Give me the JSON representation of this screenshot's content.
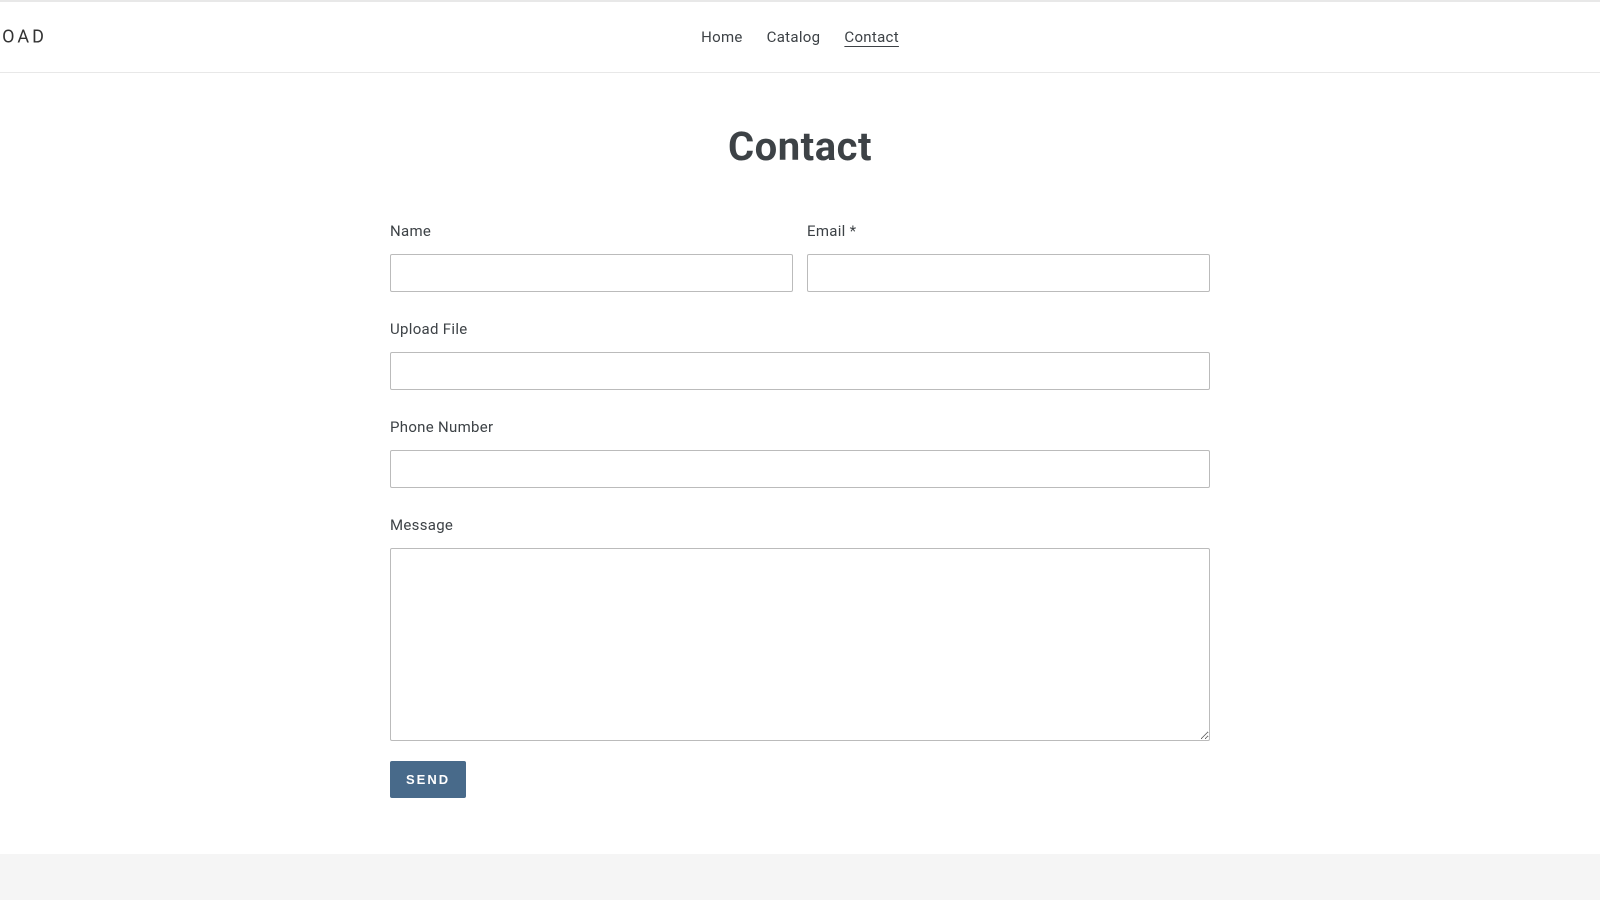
{
  "brand": "LOAD",
  "nav": {
    "home": "Home",
    "catalog": "Catalog",
    "contact": "Contact"
  },
  "page": {
    "title": "Contact"
  },
  "form": {
    "name_label": "Name",
    "email_label": "Email *",
    "upload_label": "Upload File",
    "phone_label": "Phone Number",
    "message_label": "Message",
    "send_label": "SEND",
    "name_value": "",
    "email_value": "",
    "upload_value": "",
    "phone_value": "",
    "message_value": ""
  },
  "colors": {
    "accent": "#486a8a",
    "text": "#3d4246",
    "border": "#bbbbbb",
    "divider": "#e8e8e8"
  }
}
